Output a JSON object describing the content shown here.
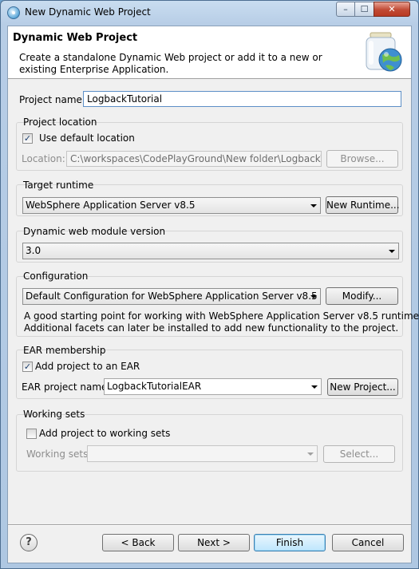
{
  "window": {
    "title": "New Dynamic Web Project",
    "controls": {
      "minimize": "–",
      "maximize": "☐",
      "close": "✕"
    }
  },
  "banner": {
    "title": "Dynamic Web Project",
    "description": "Create a standalone Dynamic Web project or add it to a new or existing Enterprise Application."
  },
  "project_name": {
    "label": "Project name:",
    "value": "LogbackTutorial"
  },
  "project_location": {
    "group_label": "Project location",
    "use_default": {
      "label": "Use default location",
      "checked": true
    },
    "location_label": "Location:",
    "location_value": "C:\\workspaces\\CodePlayGround\\New folder\\LogbackTutor",
    "browse_label": "Browse..."
  },
  "target_runtime": {
    "group_label": "Target runtime",
    "selected": "WebSphere Application Server v8.5",
    "new_runtime_label": "New Runtime..."
  },
  "module_version": {
    "group_label": "Dynamic web module version",
    "selected": "3.0"
  },
  "configuration": {
    "group_label": "Configuration",
    "selected": "Default Configuration for WebSphere Application Server v8.5",
    "modify_label": "Modify...",
    "info_line1": "A good starting point for working with WebSphere Application Server v8.5 runtime.",
    "info_line2": "Additional facets can later be installed to add new functionality to the project."
  },
  "ear_membership": {
    "group_label": "EAR membership",
    "add_to_ear": {
      "label": "Add project to an EAR",
      "checked": true
    },
    "ear_name_label": "EAR project name:",
    "ear_name_value": "LogbackTutorialEAR",
    "new_project_label": "New Project..."
  },
  "working_sets": {
    "group_label": "Working sets",
    "add_to_ws": {
      "label": "Add project to working sets",
      "checked": false
    },
    "ws_label": "Working sets:",
    "select_label": "Select..."
  },
  "footer": {
    "help_symbol": "?",
    "back_label": "< Back",
    "next_label": "Next >",
    "finish_label": "Finish",
    "cancel_label": "Cancel"
  },
  "icons": {
    "app": "eclipse-globe-icon",
    "banner": "web-project-jar-globe-icon",
    "help": "help-circle-icon",
    "check": "✓"
  }
}
